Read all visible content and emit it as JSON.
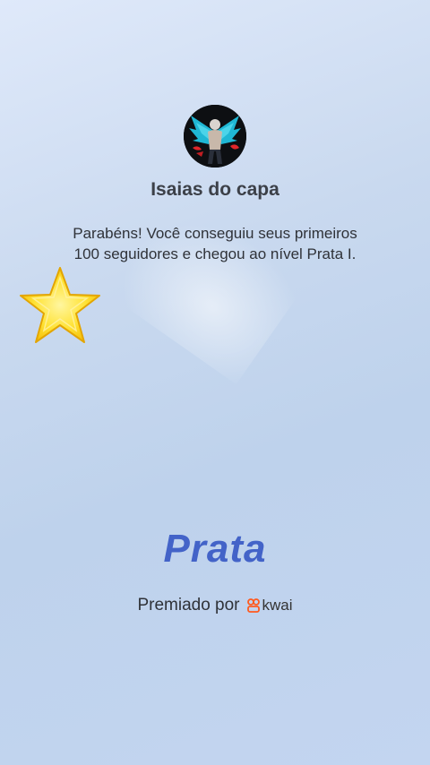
{
  "profile": {
    "name": "Isaias do capa",
    "avatar_icon": "winged-warrior-avatar"
  },
  "message": {
    "line1": "Parabéns! Você conseguiu seus primeiros",
    "line2": "100 seguidores e chegou ao nível Prata I."
  },
  "level": {
    "label": "Prata"
  },
  "awarded": {
    "prefix": "Premiado por",
    "brand": "kwai",
    "brand_icon": "kwai-logo-icon"
  },
  "colors": {
    "level_text": "#4363c8",
    "star_fill": "#ffe234",
    "brand_accent": "#ff5a1f"
  }
}
